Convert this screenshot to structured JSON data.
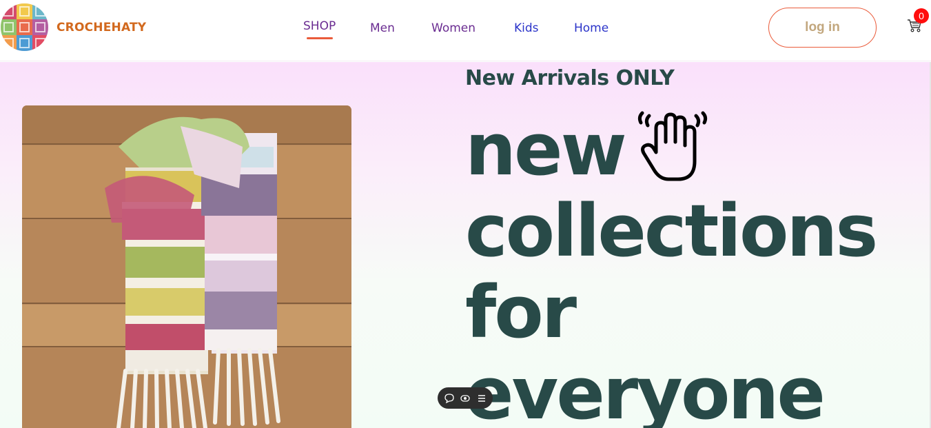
{
  "brand": {
    "name": "CROCHEHATY",
    "logo_icon": "granny-square-logo"
  },
  "nav": {
    "items": [
      {
        "label": "SHOP",
        "active": true
      },
      {
        "label": "Men"
      },
      {
        "label": "Women"
      },
      {
        "label": "Kids"
      },
      {
        "label": "Home"
      }
    ]
  },
  "header": {
    "login_label": "log in",
    "cart_count": "0",
    "cart_icon": "cart-icon"
  },
  "hero": {
    "subtitle": "New Arrivals ONLY",
    "headline": [
      "new",
      "collections",
      "for",
      "everyone"
    ],
    "headline_icon": "waving-hand-icon",
    "image": "crochet-scarf-photo"
  },
  "toolbar": {
    "icons": [
      "comment-icon",
      "eye-icon",
      "menu-icon"
    ]
  },
  "colors": {
    "brand": "#d2691e",
    "nav_purple": "#6a2c91",
    "nav_blue": "#2b34c9",
    "accent": "#ea5b3a",
    "login_text": "#c2a77e",
    "headline": "#284a48",
    "badge": "#ff0d0d"
  }
}
